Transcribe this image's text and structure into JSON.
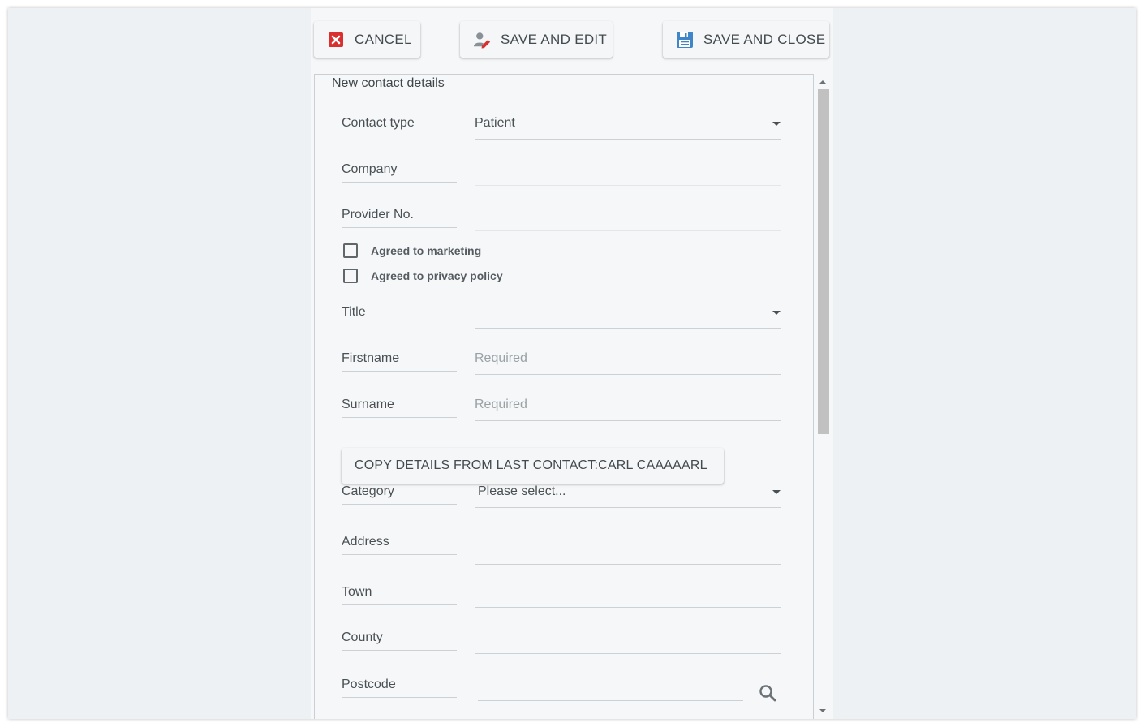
{
  "toolbar": {
    "cancel_label": "CANCEL",
    "save_edit_label": "SAVE AND EDIT",
    "save_close_label": "SAVE AND CLOSE"
  },
  "form": {
    "legend": "New contact details",
    "contact_type": {
      "label": "Contact type",
      "value": "Patient"
    },
    "company": {
      "label": "Company",
      "value": ""
    },
    "provider_no": {
      "label": "Provider No.",
      "value": ""
    },
    "agreed_marketing": {
      "label": "Agreed to marketing",
      "checked": false
    },
    "agreed_privacy": {
      "label": "Agreed to privacy policy",
      "checked": false
    },
    "title": {
      "label": "Title",
      "value": ""
    },
    "firstname": {
      "label": "Firstname",
      "placeholder": "Required"
    },
    "surname": {
      "label": "Surname",
      "placeholder": "Required"
    },
    "copy_button": "COPY DETAILS FROM LAST CONTACT:CARL CAAAAARL",
    "category": {
      "label": "Category",
      "value": "Please select..."
    },
    "address": {
      "label": "Address",
      "value": ""
    },
    "town": {
      "label": "Town",
      "value": ""
    },
    "county": {
      "label": "County",
      "value": ""
    },
    "postcode": {
      "label": "Postcode",
      "value": ""
    }
  },
  "colors": {
    "cancel_icon": "#d9302f",
    "save_icon": "#3f86c8",
    "edit_pen": "#d9302f"
  },
  "icons": {
    "cancel": "close-box-icon",
    "save_edit": "user-edit-icon",
    "save_close": "floppy-disk-icon",
    "postcode_search": "search-icon"
  }
}
